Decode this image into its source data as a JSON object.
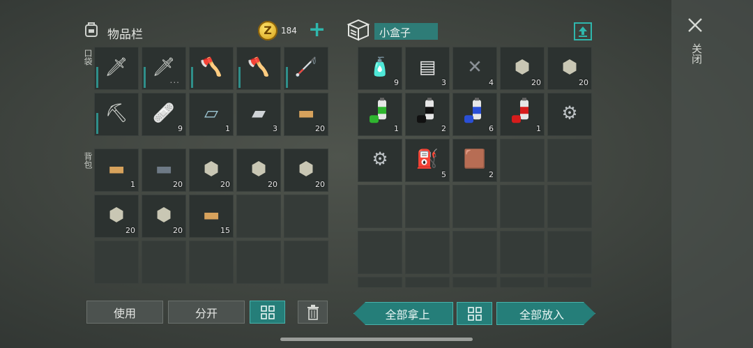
{
  "inventory": {
    "title": "物品栏",
    "coin_count": "184",
    "add_label": "+",
    "pocket_label": "口袋",
    "backpack_label": "背包",
    "pocket_rows": [
      [
        {
          "name": "machete",
          "icon": "machete-icon",
          "count": "",
          "durability": true
        },
        {
          "name": "serrated-machete",
          "icon": "serrated-machete-icon",
          "count": "",
          "durability": true,
          "dots": "..."
        },
        {
          "name": "hatchet",
          "icon": "hatchet-icon",
          "count": "",
          "durability": true
        },
        {
          "name": "hatchet-2",
          "icon": "hatchet-icon",
          "count": "",
          "durability": true
        },
        {
          "name": "crowbar",
          "icon": "crowbar-icon",
          "count": "",
          "durability": true
        }
      ],
      [
        {
          "name": "pickaxe",
          "icon": "pickaxe-icon",
          "count": "",
          "durability": true
        },
        {
          "name": "bandage",
          "icon": "bandage-icon",
          "count": "9",
          "durability": false
        },
        {
          "name": "glass",
          "icon": "glass-sheet-icon",
          "count": "1",
          "durability": false
        },
        {
          "name": "metal-sheet",
          "icon": "metal-sheet-icon",
          "count": "3",
          "durability": false
        },
        {
          "name": "wood-plank",
          "icon": "plank-icon",
          "count": "20",
          "durability": false
        }
      ]
    ],
    "backpack_rows": [
      [
        {
          "name": "plank",
          "icon": "plank-icon",
          "count": "1"
        },
        {
          "name": "iron-ingot",
          "icon": "ingot-icon",
          "count": "20"
        },
        {
          "name": "stone",
          "icon": "stone-icon",
          "count": "20"
        },
        {
          "name": "stone-2",
          "icon": "stone-icon",
          "count": "20"
        },
        {
          "name": "stone-3",
          "icon": "stone-icon",
          "count": "20"
        }
      ],
      [
        {
          "name": "stone-4",
          "icon": "stone-icon",
          "count": "20"
        },
        {
          "name": "stone-5",
          "icon": "stone-icon",
          "count": "20"
        },
        {
          "name": "light-plank",
          "icon": "plank-icon",
          "count": "15"
        },
        null,
        null
      ],
      [
        null,
        null,
        null,
        null,
        null
      ]
    ],
    "buttons": {
      "use": "使用",
      "split": "分开"
    }
  },
  "box": {
    "title": "小盒子",
    "rows": [
      [
        {
          "name": "water-bottle",
          "icon": "bottle-icon",
          "count": "9"
        },
        {
          "name": "aluminum-bars",
          "icon": "bars-icon",
          "count": "3"
        },
        {
          "name": "nails",
          "icon": "nails-icon",
          "count": "4"
        },
        {
          "name": "stone",
          "icon": "stone-icon",
          "count": "20"
        },
        {
          "name": "stone-2",
          "icon": "stone-icon",
          "count": "20"
        }
      ],
      [
        {
          "name": "green-paint",
          "icon": "spray-green-icon",
          "count": "1",
          "color": "#2fb52f"
        },
        {
          "name": "black-paint",
          "icon": "spray-black-icon",
          "count": "2",
          "color": "#111111"
        },
        {
          "name": "blue-paint",
          "icon": "spray-blue-icon",
          "count": "6",
          "color": "#2a4fd6"
        },
        {
          "name": "red-paint",
          "icon": "spray-red-icon",
          "count": "1",
          "color": "#d61c1c"
        },
        {
          "name": "saw-blade",
          "icon": "saw-blade-icon",
          "count": ""
        }
      ],
      [
        {
          "name": "saw-blade-2",
          "icon": "saw-blade-icon",
          "count": ""
        },
        {
          "name": "jerry-can",
          "icon": "jerry-can-icon",
          "count": "5"
        },
        {
          "name": "leather",
          "icon": "leather-icon",
          "count": "2"
        },
        null,
        null
      ],
      [
        null,
        null,
        null,
        null,
        null
      ],
      [
        null,
        null,
        null,
        null,
        null
      ],
      [
        null,
        null,
        null,
        null,
        null
      ]
    ],
    "buttons": {
      "take_all": "全部拿上",
      "put_all": "全部放入"
    }
  },
  "close_label": "关闭",
  "accent": "#2f8f8a"
}
